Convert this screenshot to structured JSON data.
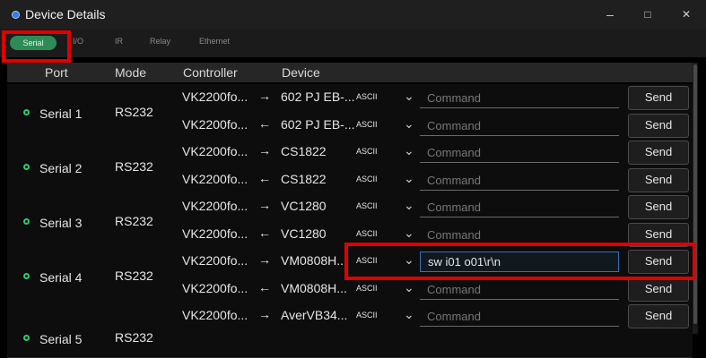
{
  "window": {
    "title": "Device Details",
    "minimize": "–",
    "maximize": "□",
    "close": "✕"
  },
  "tabs": [
    "Serial",
    "I/O",
    "IR",
    "Relay",
    "Ethernet"
  ],
  "columns": {
    "port": "Port",
    "mode": "Mode",
    "controller": "Controller",
    "device": "Device"
  },
  "groups": [
    {
      "port": "Serial 1",
      "mode": "RS232",
      "rows": [
        {
          "controller": "VK2200fo...",
          "arrow": "→",
          "device": "602 PJ EB-...",
          "encoding": "ASCII",
          "command": "",
          "placeholder": "Command",
          "send": "Send"
        },
        {
          "controller": "VK2200fo...",
          "arrow": "←",
          "device": "602 PJ EB-...",
          "encoding": "ASCII",
          "command": "",
          "placeholder": "Command",
          "send": "Send"
        }
      ]
    },
    {
      "port": "Serial 2",
      "mode": "RS232",
      "rows": [
        {
          "controller": "VK2200fo...",
          "arrow": "→",
          "device": "CS1822",
          "encoding": "ASCII",
          "command": "",
          "placeholder": "Command",
          "send": "Send"
        },
        {
          "controller": "VK2200fo...",
          "arrow": "←",
          "device": "CS1822",
          "encoding": "ASCII",
          "command": "",
          "placeholder": "Command",
          "send": "Send"
        }
      ]
    },
    {
      "port": "Serial 3",
      "mode": "RS232",
      "rows": [
        {
          "controller": "VK2200fo...",
          "arrow": "→",
          "device": "VC1280",
          "encoding": "ASCII",
          "command": "",
          "placeholder": "Command",
          "send": "Send"
        },
        {
          "controller": "VK2200fo...",
          "arrow": "←",
          "device": "VC1280",
          "encoding": "ASCII",
          "command": "",
          "placeholder": "Command",
          "send": "Send"
        }
      ]
    },
    {
      "port": "Serial 4",
      "mode": "RS232",
      "rows": [
        {
          "controller": "VK2200fo...",
          "arrow": "→",
          "device": "VM0808H...",
          "encoding": "ASCII",
          "command": "sw i01 o01\\r\\n",
          "placeholder": "Command",
          "send": "Send"
        },
        {
          "controller": "VK2200fo...",
          "arrow": "←",
          "device": "VM0808H...",
          "encoding": "ASCII",
          "command": "",
          "placeholder": "Command",
          "send": "Send"
        }
      ]
    },
    {
      "port": "Serial 5",
      "mode": "RS232",
      "rows": [
        {
          "controller": "VK2200fo...",
          "arrow": "→",
          "device": "AverVB34...",
          "encoding": "ASCII",
          "command": "",
          "placeholder": "Command",
          "send": "Send"
        }
      ]
    }
  ],
  "colors": {
    "accent": "#2e8b57",
    "highlight": "#e00000"
  }
}
